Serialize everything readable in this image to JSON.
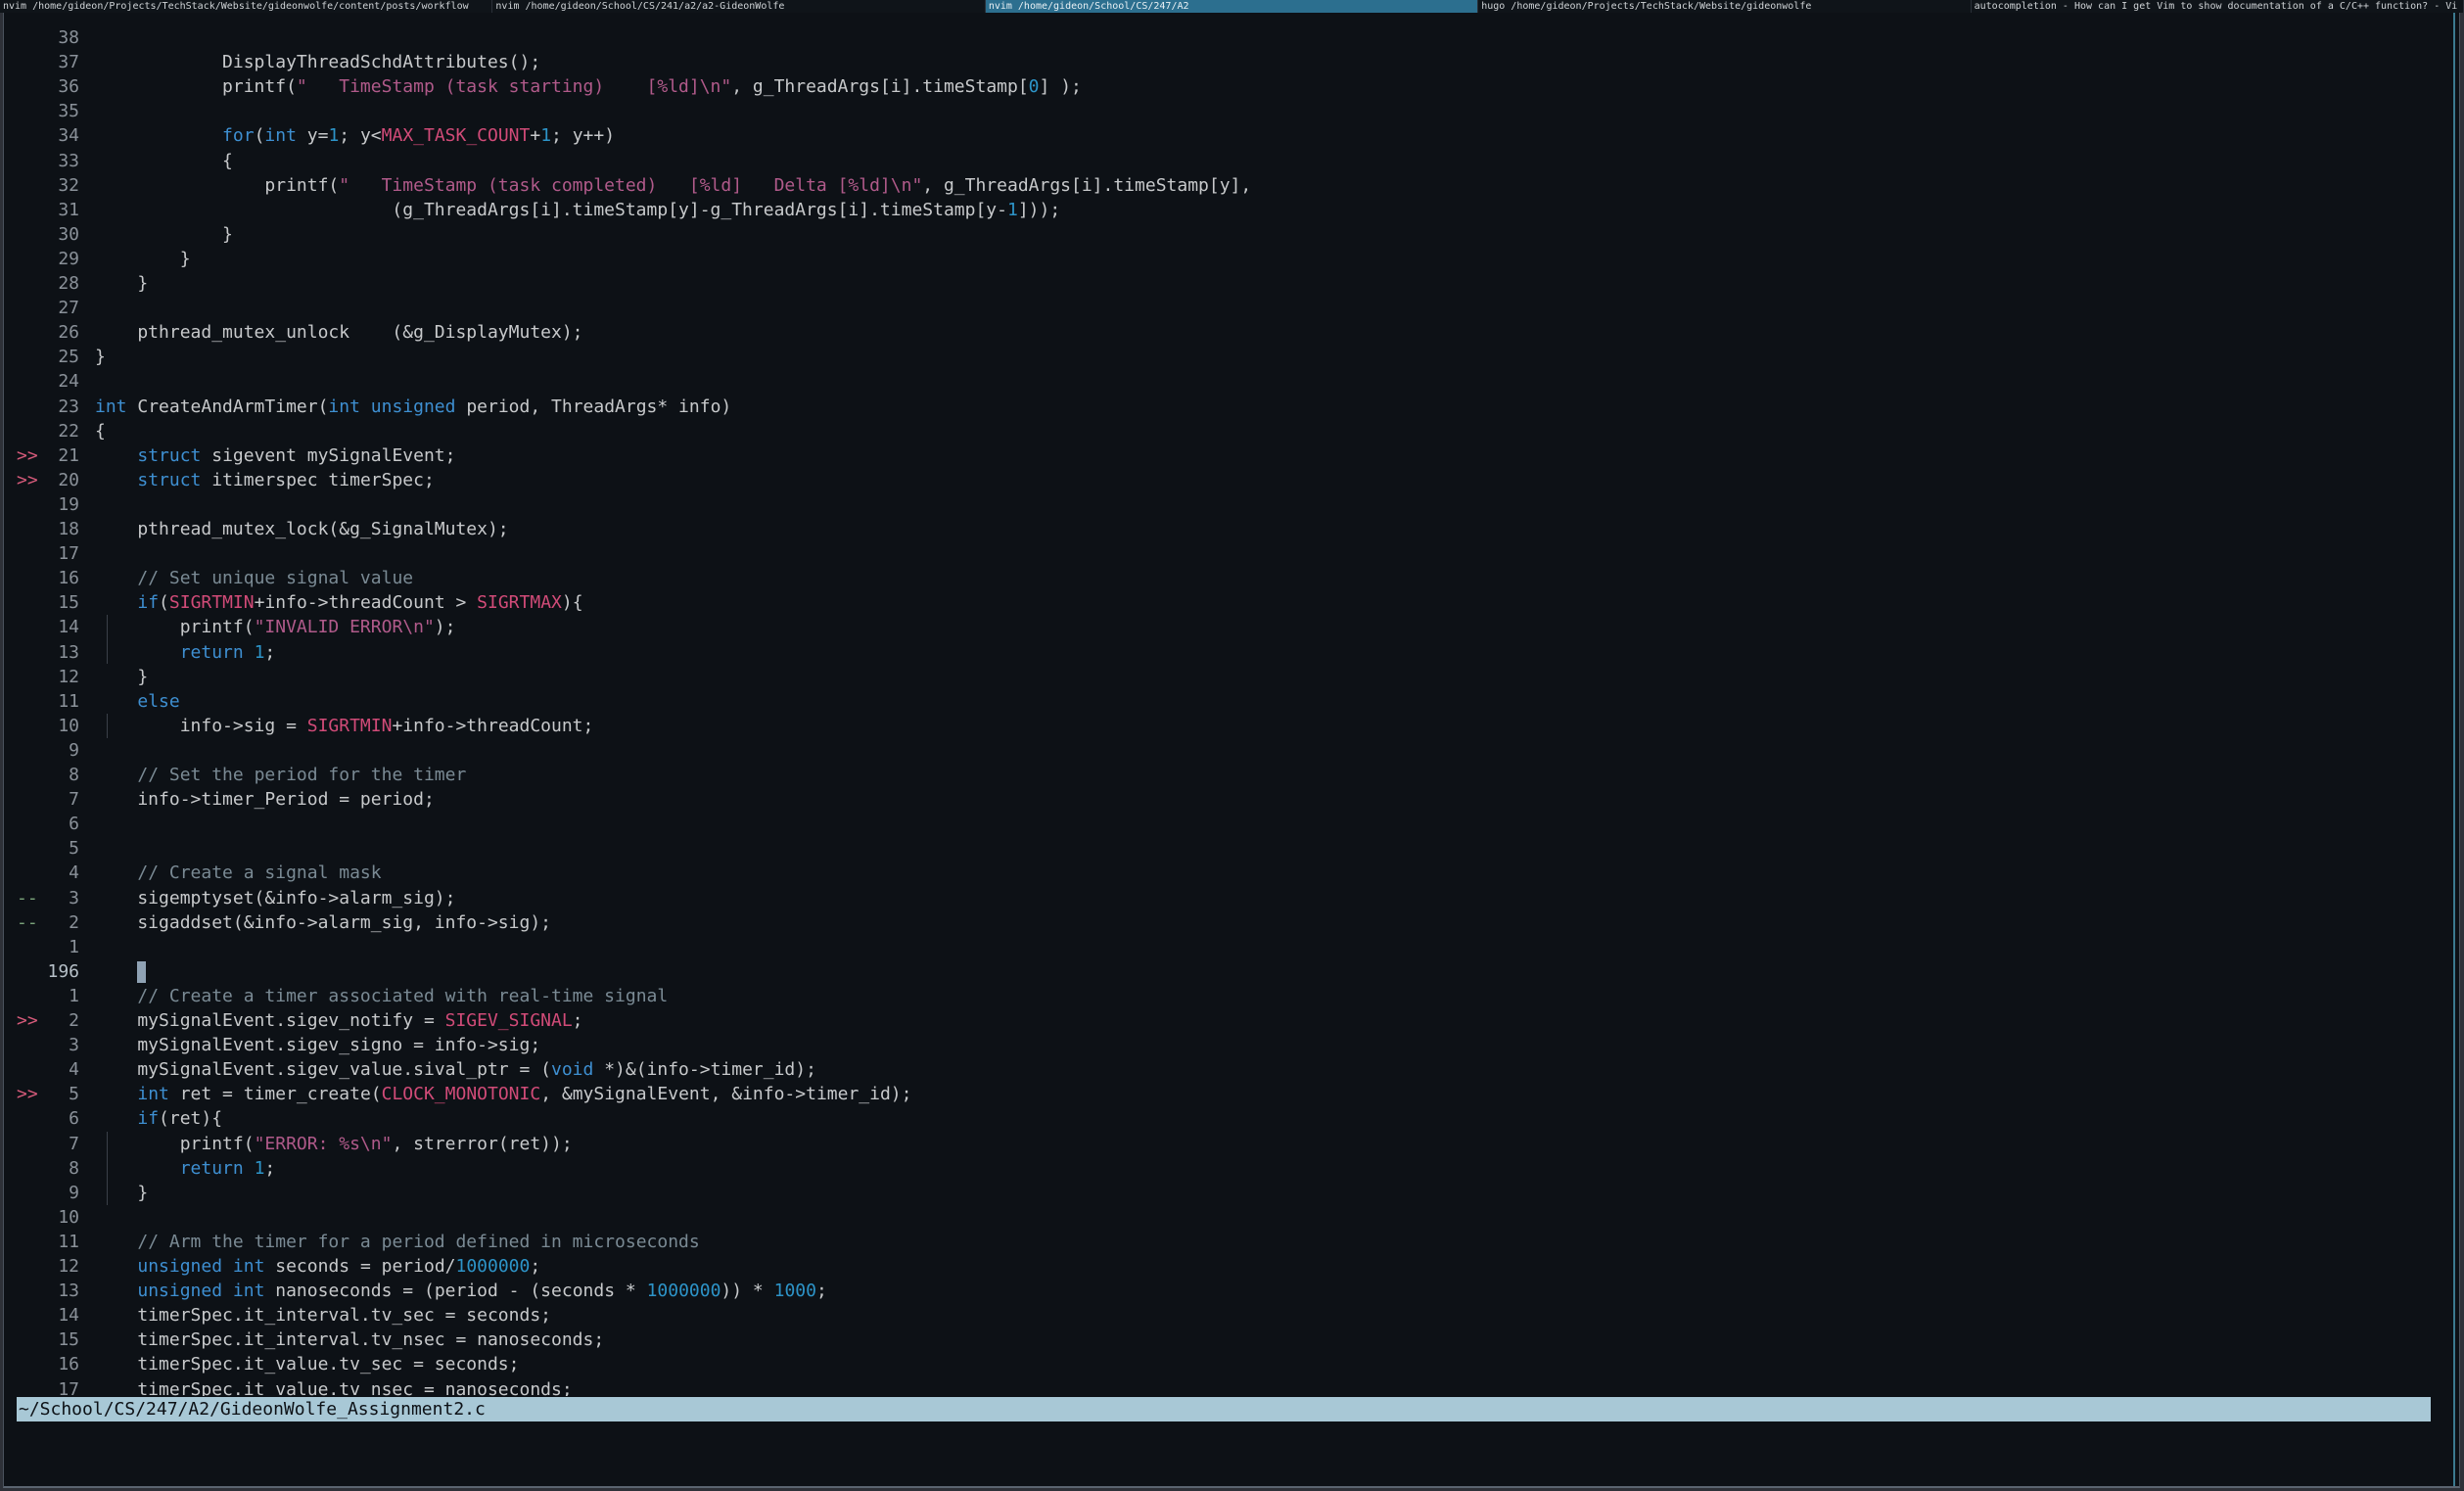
{
  "tabs": [
    {
      "label": "nvim /home/gideon/Projects/TechStack/Website/gideonwolfe/content/posts/workflow",
      "active": false
    },
    {
      "label": "nvim /home/gideon/School/CS/241/a2/a2-GideonWolfe",
      "active": false
    },
    {
      "label": "nvim /home/gideon/School/CS/247/A2",
      "active": true
    },
    {
      "label": "hugo /home/gideon/Projects/TechStack/Website/gideonwolfe",
      "active": false
    },
    {
      "label": "autocompletion - How can I get Vim to show documentation of a C/C++ function? - Vi",
      "active": false
    }
  ],
  "colors": {
    "keyword": "#3e8fd1",
    "constant": "#d14b78",
    "string": "#b05a8a",
    "number": "#2d94c8",
    "comment": "#7a8a94",
    "statusbar": "#a8c8d6",
    "active_tab": "#2c6f8f",
    "background": "#0d1116"
  },
  "editor": {
    "lines": [
      {
        "g": "",
        "n": "38",
        "t": ""
      },
      {
        "g": "",
        "n": "37",
        "t": "            DisplayThreadSchdAttributes();"
      },
      {
        "g": "",
        "n": "36",
        "t": "            printf(\"   TimeStamp (task starting)    [%ld]\\n\", g_ThreadArgs[i].timeStamp[0] );"
      },
      {
        "g": "",
        "n": "35",
        "t": ""
      },
      {
        "g": "",
        "n": "34",
        "t": "            for(int y=1; y<MAX_TASK_COUNT+1; y++)"
      },
      {
        "g": "",
        "n": "33",
        "t": "            {"
      },
      {
        "g": "",
        "n": "32",
        "t": "                printf(\"   TimeStamp (task completed)   [%ld]   Delta [%ld]\\n\", g_ThreadArgs[i].timeStamp[y],"
      },
      {
        "g": "",
        "n": "31",
        "t": "                            (g_ThreadArgs[i].timeStamp[y]-g_ThreadArgs[i].timeStamp[y-1]));"
      },
      {
        "g": "",
        "n": "30",
        "t": "            }"
      },
      {
        "g": "",
        "n": "29",
        "t": "        }"
      },
      {
        "g": "",
        "n": "28",
        "t": "    }"
      },
      {
        "g": "",
        "n": "27",
        "t": ""
      },
      {
        "g": "",
        "n": "26",
        "t": "    pthread_mutex_unlock    (&g_DisplayMutex);"
      },
      {
        "g": "",
        "n": "25",
        "t": "}"
      },
      {
        "g": "",
        "n": "24",
        "t": ""
      },
      {
        "g": "",
        "n": "23",
        "t": "int CreateAndArmTimer(int unsigned period, ThreadArgs* info)"
      },
      {
        "g": "",
        "n": "22",
        "t": "{"
      },
      {
        "g": ">>",
        "n": "21",
        "t": "    struct sigevent mySignalEvent;"
      },
      {
        "g": ">>",
        "n": "20",
        "t": "    struct itimerspec timerSpec;"
      },
      {
        "g": "",
        "n": "19",
        "t": ""
      },
      {
        "g": "",
        "n": "18",
        "t": "    pthread_mutex_lock(&g_SignalMutex);"
      },
      {
        "g": "",
        "n": "17",
        "t": ""
      },
      {
        "g": "",
        "n": "16",
        "t": "    // Set unique signal value"
      },
      {
        "g": "",
        "n": "15",
        "t": "    if(SIGRTMIN+info->threadCount > SIGRTMAX){"
      },
      {
        "g": "",
        "n": "14",
        "t": "        printf(\"INVALID ERROR\\n\");"
      },
      {
        "g": "",
        "n": "13",
        "t": "        return 1;"
      },
      {
        "g": "",
        "n": "12",
        "t": "    }"
      },
      {
        "g": "",
        "n": "11",
        "t": "    else"
      },
      {
        "g": "",
        "n": "10",
        "t": "        info->sig = SIGRTMIN+info->threadCount;"
      },
      {
        "g": "",
        "n": "9",
        "t": ""
      },
      {
        "g": "",
        "n": "8",
        "t": "    // Set the period for the timer"
      },
      {
        "g": "",
        "n": "7",
        "t": "    info->timer_Period = period;"
      },
      {
        "g": "",
        "n": "6",
        "t": ""
      },
      {
        "g": "",
        "n": "5",
        "t": ""
      },
      {
        "g": "",
        "n": "4",
        "t": "    // Create a signal mask"
      },
      {
        "g": "--",
        "n": "3",
        "t": "    sigemptyset(&info->alarm_sig);"
      },
      {
        "g": "--",
        "n": "2",
        "t": "    sigaddset(&info->alarm_sig, info->sig);"
      },
      {
        "g": "",
        "n": "1",
        "t": ""
      },
      {
        "g": "",
        "n": "196",
        "t": "",
        "current": true
      },
      {
        "g": "",
        "n": "1",
        "t": "    // Create a timer associated with real-time signal"
      },
      {
        "g": ">>",
        "n": "2",
        "t": "    mySignalEvent.sigev_notify = SIGEV_SIGNAL;"
      },
      {
        "g": "",
        "n": "3",
        "t": "    mySignalEvent.sigev_signo = info->sig;"
      },
      {
        "g": "",
        "n": "4",
        "t": "    mySignalEvent.sigev_value.sival_ptr = (void *)&(info->timer_id);"
      },
      {
        "g": ">>",
        "n": "5",
        "t": "    int ret = timer_create(CLOCK_MONOTONIC, &mySignalEvent, &info->timer_id);"
      },
      {
        "g": "",
        "n": "6",
        "t": "    if(ret){"
      },
      {
        "g": "",
        "n": "7",
        "t": "        printf(\"ERROR: %s\\n\", strerror(ret));"
      },
      {
        "g": "",
        "n": "8",
        "t": "        return 1;"
      },
      {
        "g": "",
        "n": "9",
        "t": "    }"
      },
      {
        "g": "",
        "n": "10",
        "t": ""
      },
      {
        "g": "",
        "n": "11",
        "t": "    // Arm the timer for a period defined in microseconds"
      },
      {
        "g": "",
        "n": "12",
        "t": "    unsigned int seconds = period/1000000;"
      },
      {
        "g": "",
        "n": "13",
        "t": "    unsigned int nanoseconds = (period - (seconds * 1000000)) * 1000;"
      },
      {
        "g": "",
        "n": "14",
        "t": "    timerSpec.it_interval.tv_sec = seconds;"
      },
      {
        "g": "",
        "n": "15",
        "t": "    timerSpec.it_interval.tv_nsec = nanoseconds;"
      },
      {
        "g": "",
        "n": "16",
        "t": "    timerSpec.it_value.tv_sec = seconds;"
      },
      {
        "g": "",
        "n": "17",
        "t": "    timerSpec.it_value.tv_nsec = nanoseconds;"
      }
    ]
  },
  "statusbar": {
    "filepath": "~/School/CS/247/A2/GideonWolfe_Assignment2.c"
  }
}
